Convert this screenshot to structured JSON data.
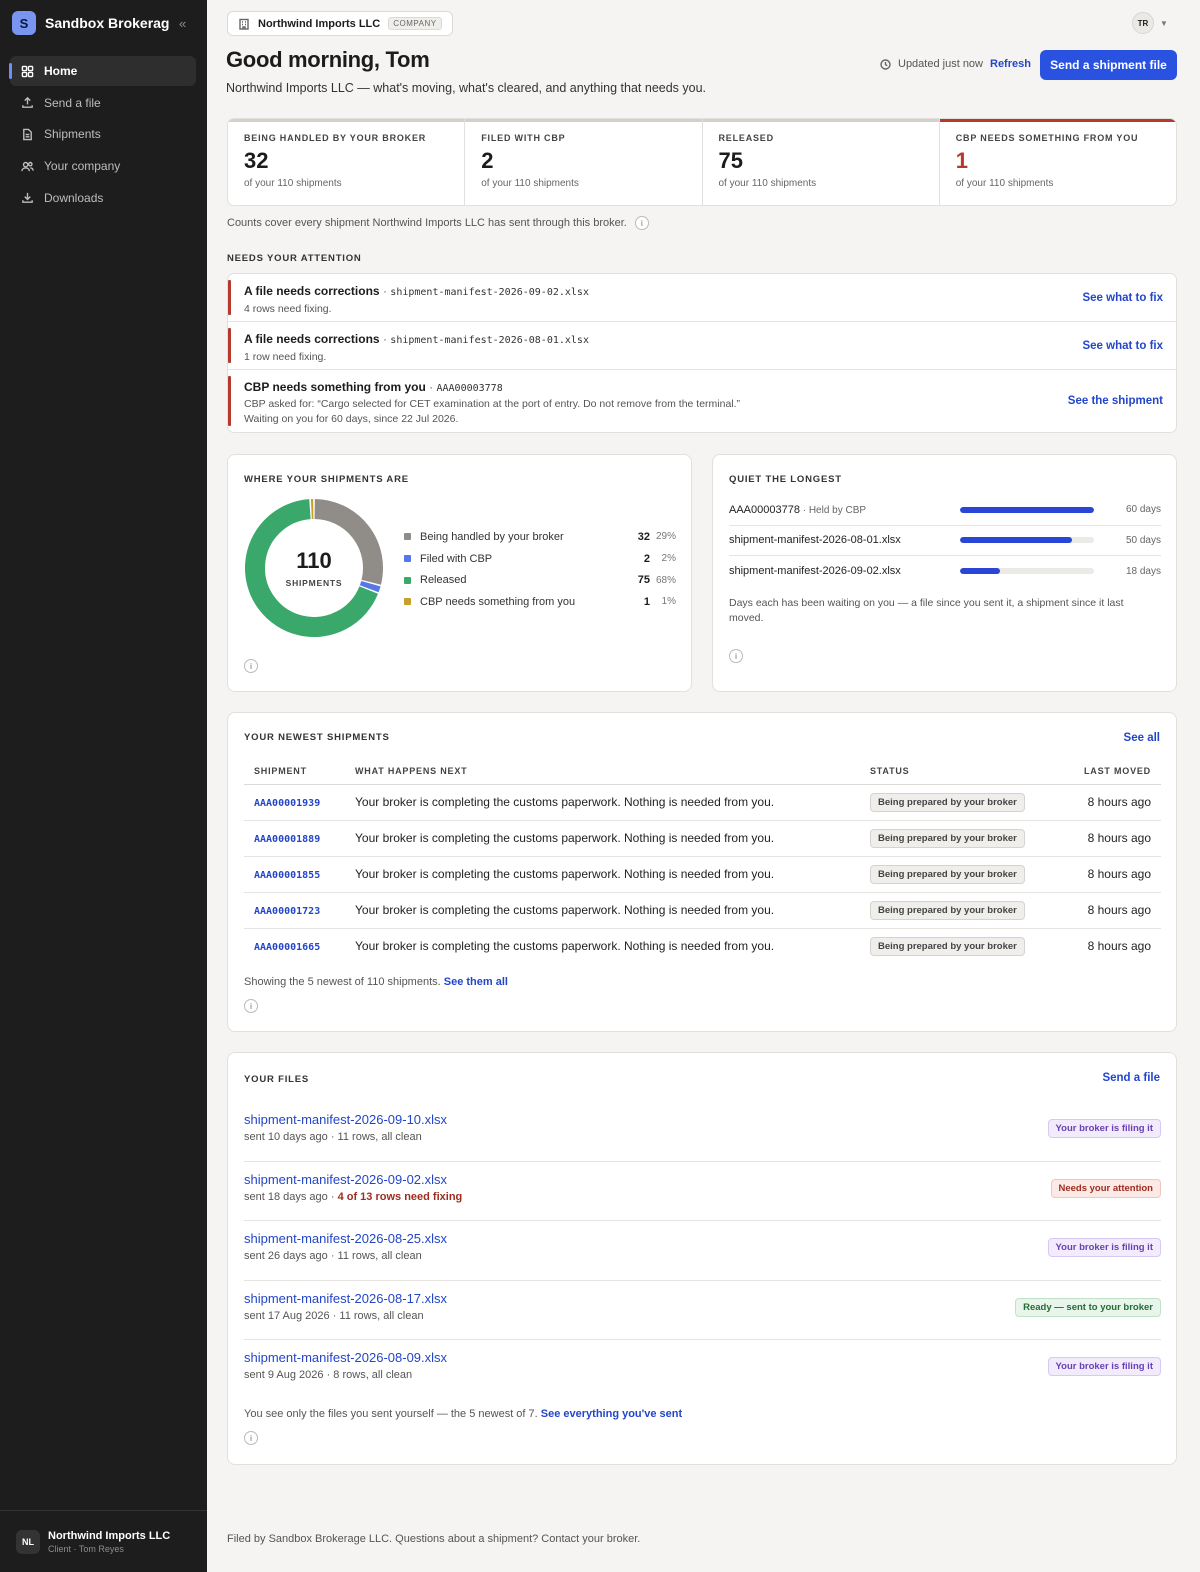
{
  "sidebar": {
    "brand_initial": "S",
    "brand_name": "Sandbox Brokerage LLC",
    "collapse_glyph": "«",
    "items": [
      {
        "label": "Home",
        "icon": "grid-icon"
      },
      {
        "label": "Send a file",
        "icon": "upload-icon"
      },
      {
        "label": "Shipments",
        "icon": "document-icon"
      },
      {
        "label": "Your company",
        "icon": "users-icon"
      },
      {
        "label": "Downloads",
        "icon": "download-icon"
      }
    ],
    "footer": {
      "initials": "NL",
      "name": "Northwind Imports LLC",
      "sub": "Client · Tom Reyes"
    }
  },
  "header": {
    "company_name": "Northwind Imports LLC",
    "company_tag": "COMPANY",
    "user_initials": "TR",
    "greeting": "Good morning, Tom",
    "subtitle": "Northwind Imports LLC — what's moving, what's cleared, and anything that needs you.",
    "updated": "Updated just now",
    "refresh": "Refresh",
    "send_button": "Send a shipment file"
  },
  "stats": [
    {
      "label": "BEING HANDLED BY YOUR BROKER",
      "value": "32",
      "sub": "of your 110 shipments"
    },
    {
      "label": "FILED WITH CBP",
      "value": "2",
      "sub": "of your 110 shipments"
    },
    {
      "label": "RELEASED",
      "value": "75",
      "sub": "of your 110 shipments"
    },
    {
      "label": "CBP NEEDS SOMETHING FROM YOU",
      "value": "1",
      "sub": "of your 110 shipments"
    }
  ],
  "counts_note": "Counts cover every shipment Northwind Imports LLC has sent through this broker.",
  "info_glyph": "i",
  "attention": {
    "label": "NEEDS YOUR ATTENTION",
    "items": [
      {
        "title": "A file needs corrections",
        "ref": "shipment-manifest-2026-09-02.xlsx",
        "sub1": "4 rows need fixing.",
        "sub2": "",
        "link": "See what to fix"
      },
      {
        "title": "A file needs corrections",
        "ref": "shipment-manifest-2026-08-01.xlsx",
        "sub1": "1 row need fixing.",
        "sub2": "",
        "link": "See what to fix"
      },
      {
        "title": "CBP needs something from you",
        "ref": "AAA00003778",
        "sub1": "CBP asked for: “Cargo selected for CET examination at the port of entry. Do not remove from the terminal.”",
        "sub2": "Waiting on you for 60 days, since 22 Jul 2026.",
        "link": "See the shipment"
      }
    ]
  },
  "where": {
    "label": "WHERE YOUR SHIPMENTS ARE",
    "total": "110",
    "total_caption": "SHIPMENTS",
    "legend": [
      {
        "name": "Being handled by your broker",
        "count": "32",
        "pct": "29%",
        "color": "#908d88"
      },
      {
        "name": "Filed with CBP",
        "count": "2",
        "pct": "2%",
        "color": "#5577e8"
      },
      {
        "name": "Released",
        "count": "75",
        "pct": "68%",
        "color": "#3aa86a"
      },
      {
        "name": "CBP needs something from you",
        "count": "1",
        "pct": "1%",
        "color": "#c8a028"
      }
    ]
  },
  "chart_data": {
    "type": "pie",
    "categories": [
      "Being handled by your broker",
      "Filed with CBP",
      "Released",
      "CBP needs something from you"
    ],
    "values": [
      32,
      2,
      75,
      1
    ],
    "title": "WHERE YOUR SHIPMENTS ARE"
  },
  "quiet": {
    "label": "QUIET THE LONGEST",
    "max_days": 60,
    "items": [
      {
        "name": "AAA00003778",
        "held": " · Held by CBP",
        "days": 60,
        "days_label": "60 days"
      },
      {
        "name": "shipment-manifest-2026-08-01.xlsx",
        "held": "",
        "days": 50,
        "days_label": "50 days"
      },
      {
        "name": "shipment-manifest-2026-09-02.xlsx",
        "held": "",
        "days": 18,
        "days_label": "18 days"
      }
    ],
    "note": "Days each has been waiting on you — a file since you sent it, a shipment since it last moved."
  },
  "newest": {
    "label": "YOUR NEWEST SHIPMENTS",
    "see_all": "See all",
    "columns": [
      "SHIPMENT",
      "WHAT HAPPENS NEXT",
      "STATUS",
      "LAST MOVED"
    ],
    "rows": [
      {
        "id": "AAA00001939",
        "next": "Your broker is completing the customs paperwork. Nothing is needed from you.",
        "status": "Being prepared by your broker",
        "moved": "8 hours ago"
      },
      {
        "id": "AAA00001889",
        "next": "Your broker is completing the customs paperwork. Nothing is needed from you.",
        "status": "Being prepared by your broker",
        "moved": "8 hours ago"
      },
      {
        "id": "AAA00001855",
        "next": "Your broker is completing the customs paperwork. Nothing is needed from you.",
        "status": "Being prepared by your broker",
        "moved": "8 hours ago"
      },
      {
        "id": "AAA00001723",
        "next": "Your broker is completing the customs paperwork. Nothing is needed from you.",
        "status": "Being prepared by your broker",
        "moved": "8 hours ago"
      },
      {
        "id": "AAA00001665",
        "next": "Your broker is completing the customs paperwork. Nothing is needed from you.",
        "status": "Being prepared by your broker",
        "moved": "8 hours ago"
      }
    ],
    "footer_text": "Showing the 5 newest of 110 shipments. ",
    "footer_link": "See them all"
  },
  "files": {
    "label": "YOUR FILES",
    "send_link": "Send a file",
    "items": [
      {
        "name": "shipment-manifest-2026-09-10.xlsx",
        "meta": "sent 10 days ago · 11 rows, all clean",
        "warn": "",
        "status": "Your broker is filing it",
        "tone": "purple"
      },
      {
        "name": "shipment-manifest-2026-09-02.xlsx",
        "meta": "sent 18 days ago · ",
        "warn": "4 of 13 rows need fixing",
        "status": "Needs your attention",
        "tone": "red"
      },
      {
        "name": "shipment-manifest-2026-08-25.xlsx",
        "meta": "sent 26 days ago · 11 rows, all clean",
        "warn": "",
        "status": "Your broker is filing it",
        "tone": "purple"
      },
      {
        "name": "shipment-manifest-2026-08-17.xlsx",
        "meta": "sent 17 Aug 2026 · 11 rows, all clean",
        "warn": "",
        "status": "Ready — sent to your broker",
        "tone": "green"
      },
      {
        "name": "shipment-manifest-2026-08-09.xlsx",
        "meta": "sent 9 Aug 2026 · 8 rows, all clean",
        "warn": "",
        "status": "Your broker is filing it",
        "tone": "purple"
      }
    ],
    "footer_text": "You see only the files you sent yourself — the 5 newest of 7. ",
    "footer_link": "See everything you've sent"
  },
  "page_footer": "Filed by Sandbox Brokerage LLC. Questions about a shipment? Contact your broker."
}
